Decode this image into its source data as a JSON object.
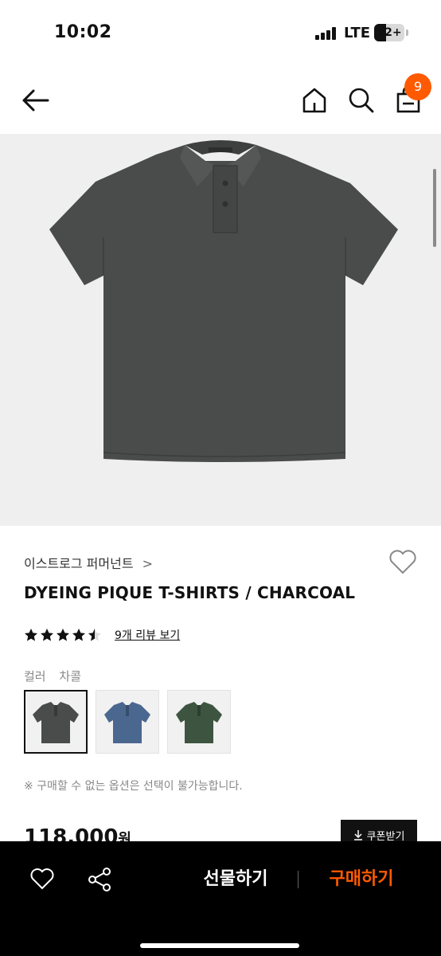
{
  "status_bar": {
    "time": "10:02",
    "network": "LTE",
    "battery": "12+"
  },
  "header": {
    "cart_count": "9"
  },
  "product": {
    "brand": "이스트로그 퍼머넌트",
    "brand_chevron": ">",
    "title": "DYEING PIQUE T-SHIRTS / CHARCOAL",
    "rating": 4.5,
    "review_link": "9개 리뷰 보기",
    "color_label": "컬러",
    "color_value": "차콜",
    "swatches": [
      {
        "name": "charcoal",
        "color": "#4a4b4b",
        "selected": true
      },
      {
        "name": "blue",
        "color": "#4a6790",
        "selected": false
      },
      {
        "name": "green",
        "color": "#3d5540",
        "selected": false
      }
    ],
    "notice": "※ 구매할 수 없는 옵션은 선택이 불가능합니다.",
    "price": "118,000",
    "price_unit": "원",
    "coupon_label": "쿠폰받기"
  },
  "bottom_bar": {
    "gift_label": "선물하기",
    "buy_label": "구매하기"
  },
  "colors": {
    "accent": "#ff5a00",
    "image_bg": "#efefef",
    "shirt": "#4a4b4b"
  }
}
